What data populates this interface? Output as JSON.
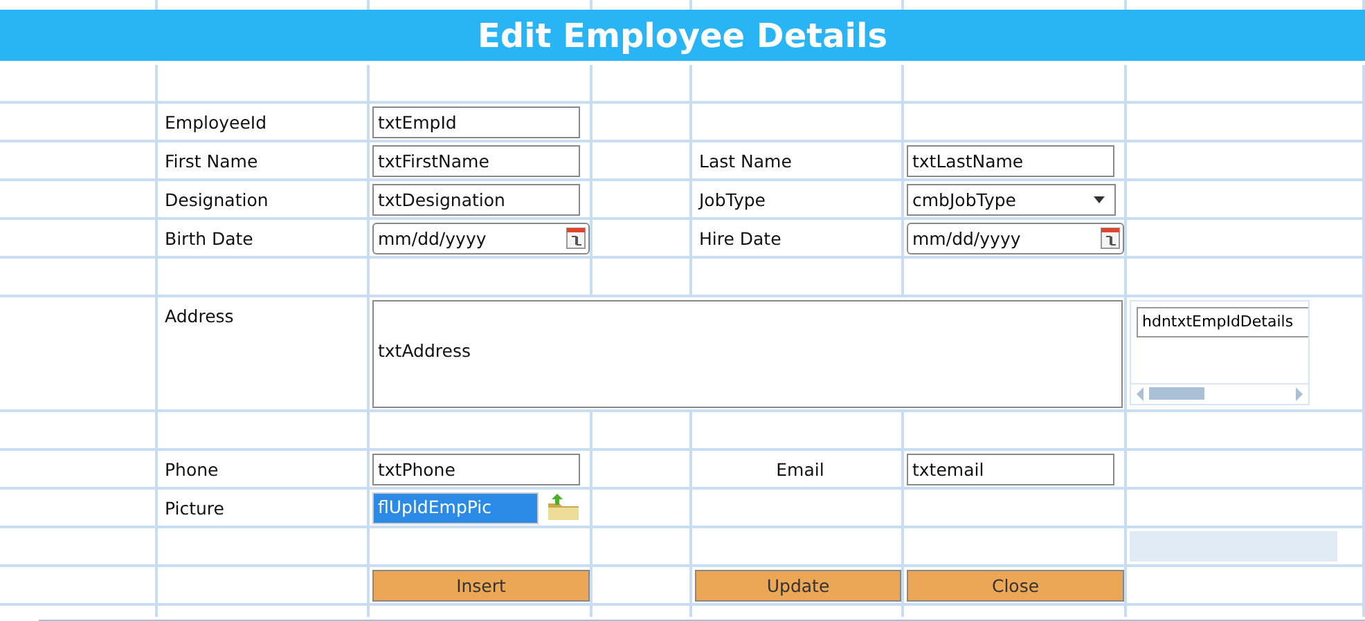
{
  "title": "Edit Employee Details",
  "rows": [
    {
      "kind": "blank"
    },
    {
      "kind": "pair",
      "left": {
        "label": "EmployeeId",
        "control": {
          "kind": "text",
          "value": "txtEmpId"
        }
      }
    },
    {
      "kind": "pair",
      "left": {
        "label": "First Name",
        "control": {
          "kind": "text",
          "value": "txtFirstName"
        }
      },
      "right": {
        "label": "Last Name",
        "control": {
          "kind": "text",
          "value": "txtLastName"
        }
      }
    },
    {
      "kind": "pair",
      "left": {
        "label": "Designation",
        "control": {
          "kind": "text",
          "value": "txtDesignation"
        }
      },
      "right": {
        "label": "JobType",
        "control": {
          "kind": "select",
          "value": "cmbJobType"
        }
      }
    },
    {
      "kind": "pair",
      "left": {
        "label": "Birth Date",
        "control": {
          "kind": "date",
          "placeholder": "mm/dd/yyyy"
        }
      },
      "right": {
        "label": "Hire Date",
        "control": {
          "kind": "date",
          "placeholder": "mm/dd/yyyy"
        }
      }
    },
    {
      "kind": "blank"
    },
    {
      "kind": "address",
      "label": "Address",
      "control": {
        "kind": "textarea",
        "value": "txtAddress"
      },
      "side_field": {
        "value": "hdntxtEmpIdDetails"
      }
    },
    {
      "kind": "blank"
    },
    {
      "kind": "pair",
      "left": {
        "label": "Phone",
        "control": {
          "kind": "text",
          "value": "txtPhone"
        }
      },
      "right": {
        "label": "Email",
        "centered": true,
        "control": {
          "kind": "text",
          "value": "txtemail"
        }
      }
    },
    {
      "kind": "pair",
      "left": {
        "label": "Picture",
        "control": {
          "kind": "file",
          "value": "flUpldEmpPic",
          "highlighted": true
        }
      }
    },
    {
      "kind": "panel"
    },
    {
      "kind": "buttons",
      "buttons": [
        {
          "label": "Insert"
        },
        {
          "label": "Update"
        },
        {
          "label": "Close"
        }
      ]
    }
  ]
}
